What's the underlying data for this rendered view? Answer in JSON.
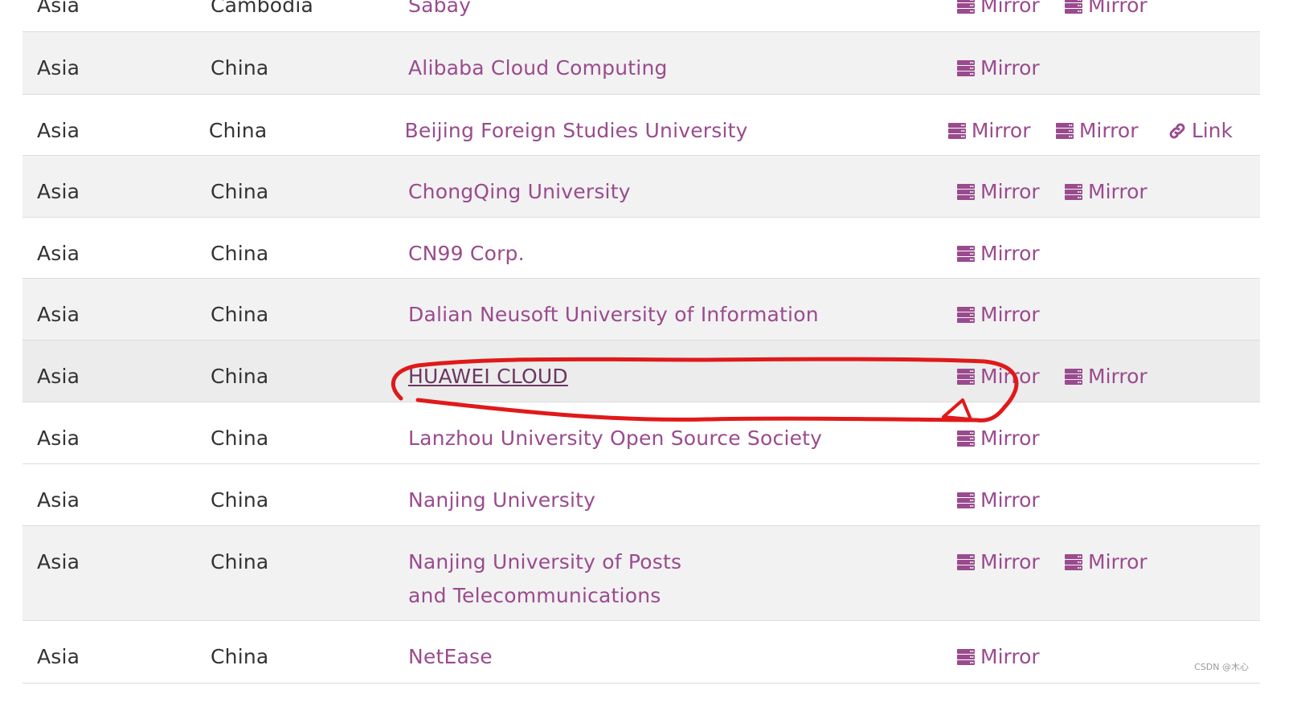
{
  "rows": [
    {
      "continent": "Asia",
      "country": "Cambodia",
      "name": "Sabay",
      "links": [
        "Mirror",
        "Mirror"
      ]
    },
    {
      "continent": "Asia",
      "country": "China",
      "name": "Alibaba Cloud Computing",
      "links": [
        "Mirror"
      ]
    },
    {
      "continent": "Asia",
      "country": "China",
      "name": "Beijing Foreign Studies University",
      "links": [
        "Mirror",
        "Mirror",
        "Link"
      ]
    },
    {
      "continent": "Asia",
      "country": "China",
      "name": "ChongQing University",
      "links": [
        "Mirror",
        "Mirror"
      ]
    },
    {
      "continent": "Asia",
      "country": "China",
      "name": "CN99 Corp.",
      "links": [
        "Mirror"
      ]
    },
    {
      "continent": "Asia",
      "country": "China",
      "name": "Dalian Neusoft University of Information",
      "links": [
        "Mirror"
      ]
    },
    {
      "continent": "Asia",
      "country": "China",
      "name": "HUAWEI CLOUD",
      "links": [
        "Mirror",
        "Mirror"
      ]
    },
    {
      "continent": "Asia",
      "country": "China",
      "name": "Lanzhou University Open Source Society",
      "links": [
        "Mirror"
      ]
    },
    {
      "continent": "Asia",
      "country": "China",
      "name": "Nanjing University",
      "links": [
        "Mirror"
      ]
    },
    {
      "continent": "Asia",
      "country": "China",
      "name": "Nanjing University of Posts and Telecommunications",
      "links": [
        "Mirror",
        "Mirror"
      ]
    },
    {
      "continent": "Asia",
      "country": "China",
      "name": "NetEase",
      "links": [
        "Mirror"
      ]
    }
  ],
  "icons": {
    "mirror": "server-icon",
    "link": "chain-link-icon"
  },
  "colors": {
    "accent": "#9a4b8e",
    "annotation": "#e0191a",
    "stripe": "#f2f2f2"
  },
  "watermark": "CSDN @木心"
}
